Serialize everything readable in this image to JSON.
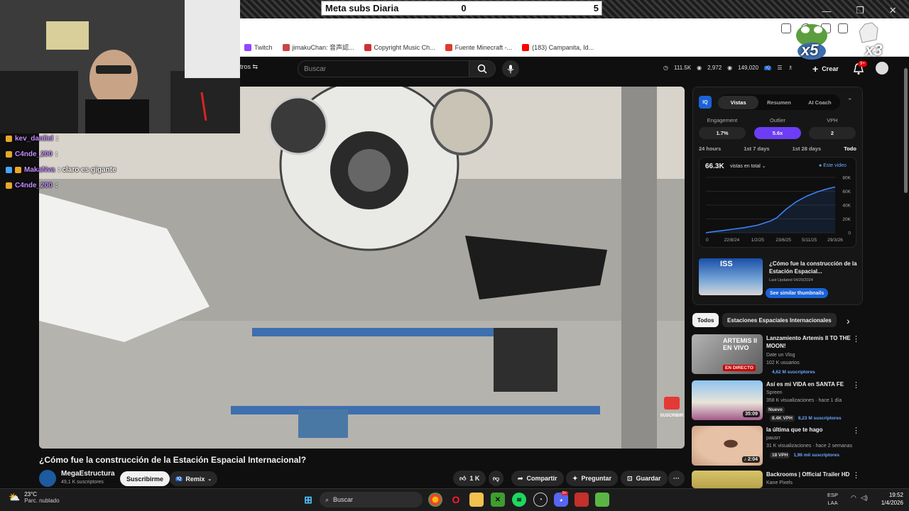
{
  "overlay": {
    "meta_label": "Meta subs Diaria",
    "meta_current": "0",
    "meta_goal": "5",
    "frog_count": "x5",
    "clap_count": "x3"
  },
  "bookmarks": [
    {
      "label": "Twitch",
      "color": "#9146ff"
    },
    {
      "label": "jimakuChan: 音声認...",
      "color": "#cc4444"
    },
    {
      "label": "Copyright Music Ch...",
      "color": "#d03030"
    },
    {
      "label": "Fuente Minecraft -...",
      "color": "#e03b2d"
    },
    {
      "label": "(183) Campanita, Id...",
      "color": "#ff0000"
    }
  ],
  "youtube": {
    "filters_label": "tros",
    "search_placeholder": "Buscar",
    "stats": [
      "111.5K",
      "2,972",
      "149,020"
    ],
    "create_label": "Crear",
    "notif_badge": "9+"
  },
  "chat": [
    {
      "user": "kev_daniiel",
      "msg": ":",
      "color": "#c58cff"
    },
    {
      "user": "C4nde_200",
      "msg": ":",
      "color": "#c58cff"
    },
    {
      "user": "MakaNva",
      "msg": ": claro es gigante",
      "color": "#c58cff"
    },
    {
      "user": "C4nde_200",
      "msg": ":",
      "color": "#c58cff"
    }
  ],
  "video": {
    "title": "¿Cómo fue la construcción de la Estación Espacial Internacional?",
    "channel": "MegaEstructura",
    "subs": "49,1 K suscriptores",
    "subscribe_label": "Suscribirme",
    "remix_label": "Remix",
    "likes": "1 K",
    "share_label": "Compartir",
    "ask_label": "Preguntar",
    "save_label": "Guardar",
    "watermark": "SUSCRIBIR"
  },
  "vidiq": {
    "tabs": [
      "Vistas",
      "Resumen",
      "AI Coach"
    ],
    "active_tab": "Vistas",
    "logo": "IQ",
    "metrics": [
      {
        "label": "Engagement",
        "value": "1.7%"
      },
      {
        "label": "Outlier",
        "value": "5.6x"
      },
      {
        "label": "VPH",
        "value": "2"
      }
    ],
    "ranges": [
      "24 hours",
      "1st 7 days",
      "1st 28 days",
      "Todo"
    ],
    "active_range": "Todo",
    "views_total": "66.3K",
    "views_selector": "vistas en total",
    "legend": "Este video",
    "card_title": "¿Cómo fue la construcción de la Estación Espacial...",
    "card_date": "Last Updated 04/20/2024",
    "card_button": "See similar thumbnails",
    "card_thumb_text": "ISS"
  },
  "chart_data": {
    "type": "line",
    "x_ticks": [
      "0",
      "22/8/24",
      "1/2/25",
      "23/6/25",
      "5/11/25",
      "29/3/26"
    ],
    "y_ticks": [
      "0",
      "20K",
      "40K",
      "60K",
      "80K"
    ],
    "ylim": [
      0,
      80000
    ],
    "series": [
      {
        "name": "Este video",
        "color": "#3b82f6",
        "x": [
          0,
          0.05,
          0.12,
          0.2,
          0.3,
          0.4,
          0.5,
          0.55,
          0.62,
          0.7,
          0.78,
          0.86,
          0.93,
          1.0
        ],
        "y": [
          0,
          1500,
          3000,
          5000,
          7500,
          11000,
          17000,
          22000,
          34000,
          45000,
          53000,
          59000,
          63000,
          66300
        ]
      }
    ]
  },
  "chips": {
    "all": "Todos",
    "topic": "Estaciones Espaciales Internacionales"
  },
  "recommendations": [
    {
      "title": "Lanzamiento Artemis II TO THE MOON!",
      "channel": "Date un Vlog",
      "meta": "102 K usuarios",
      "extra": "4,62 M suscriptores",
      "badge": "EN DIRECTO",
      "thumb_text": "ARTEMIS II EN VIVO"
    },
    {
      "title": "Así es mi VIDA en SANTA FE",
      "channel": "Spreen",
      "meta": "358 K visualizaciones · hace 1 día",
      "tag": "Nuevo",
      "vph": "8.4K VPH",
      "extra": "8,23 M suscriptores",
      "duration": "35:09"
    },
    {
      "title": "la última que te hago",
      "channel": "pausrr",
      "meta": "31 K visualizaciones · hace 2 semanas",
      "vph": "18 VPH",
      "extra": "1,96 mil suscriptores",
      "duration": "2:04"
    },
    {
      "title": "Backrooms | Official Trailer HD",
      "channel": "Kane Pixels"
    }
  ],
  "taskbar": {
    "temp": "23°C",
    "weather": "Parc. nublado",
    "search": "Buscar",
    "lang": "ESP",
    "lang2": "LAA",
    "time": "19:52",
    "date": "1/4/2026",
    "discord_badge": "9+"
  }
}
